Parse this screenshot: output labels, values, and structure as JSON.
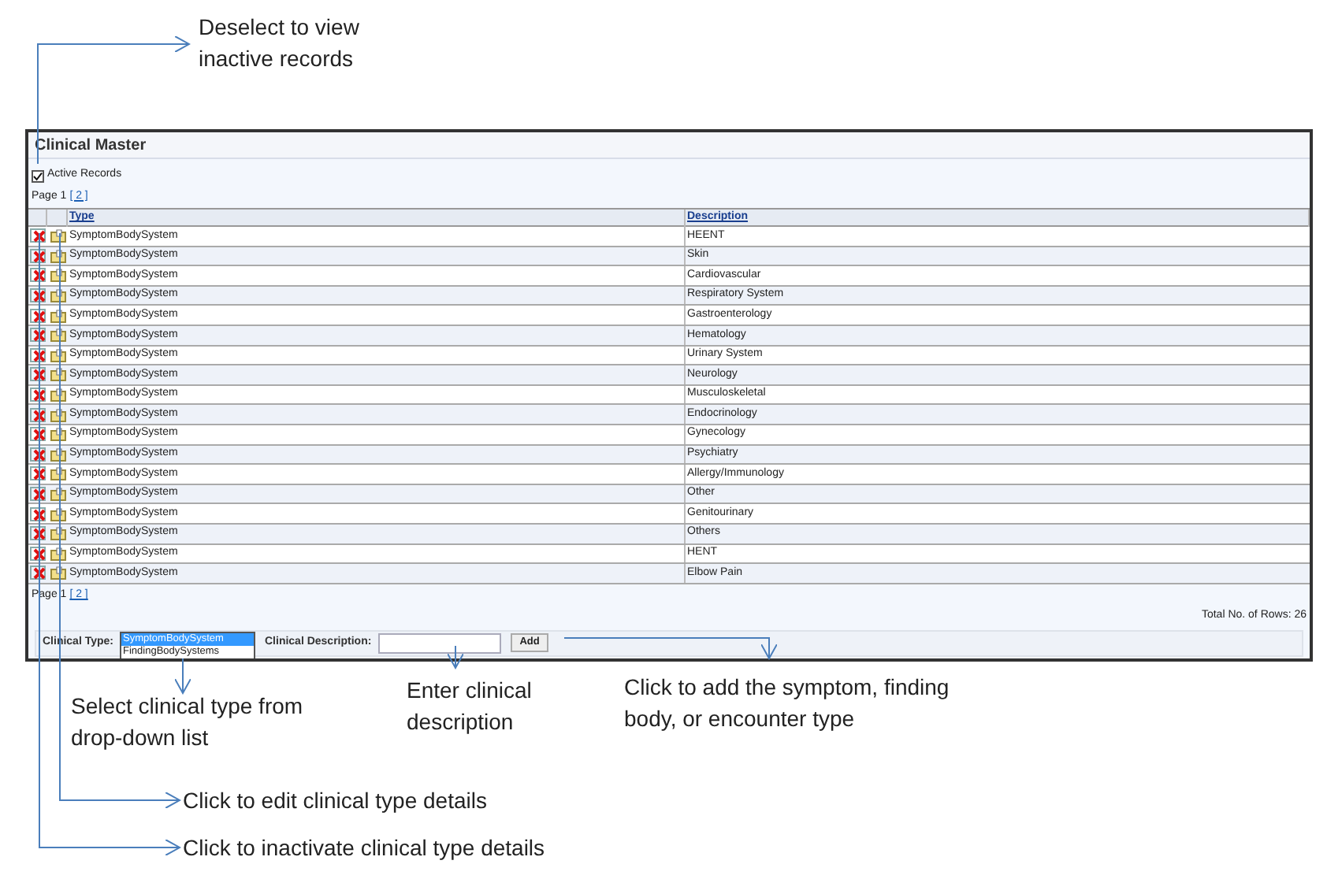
{
  "window": {
    "title": "Clinical Master"
  },
  "active_records": {
    "label": "Active Records",
    "checked": true
  },
  "pager_top": {
    "label": "Page 1",
    "link": "[ 2 ]"
  },
  "table": {
    "columns": [
      "Type",
      "Description"
    ],
    "rows": [
      {
        "type": "SymptomBodySystem",
        "description": "HEENT"
      },
      {
        "type": "SymptomBodySystem",
        "description": "Skin"
      },
      {
        "type": "SymptomBodySystem",
        "description": "Cardiovascular"
      },
      {
        "type": "SymptomBodySystem",
        "description": "Respiratory System"
      },
      {
        "type": "SymptomBodySystem",
        "description": "Gastroenterology"
      },
      {
        "type": "SymptomBodySystem",
        "description": "Hematology"
      },
      {
        "type": "SymptomBodySystem",
        "description": "Urinary System"
      },
      {
        "type": "SymptomBodySystem",
        "description": "Neurology"
      },
      {
        "type": "SymptomBodySystem",
        "description": "Musculoskeletal"
      },
      {
        "type": "SymptomBodySystem",
        "description": "Endocrinology"
      },
      {
        "type": "SymptomBodySystem",
        "description": "Gynecology"
      },
      {
        "type": "SymptomBodySystem",
        "description": "Psychiatry"
      },
      {
        "type": "SymptomBodySystem",
        "description": "Allergy/Immunology"
      },
      {
        "type": "SymptomBodySystem",
        "description": "Other"
      },
      {
        "type": "SymptomBodySystem",
        "description": "Genitourinary"
      },
      {
        "type": "SymptomBodySystem",
        "description": "Others"
      },
      {
        "type": "SymptomBodySystem",
        "description": "HENT"
      },
      {
        "type": "SymptomBodySystem",
        "description": "Elbow Pain"
      }
    ]
  },
  "pager_bottom": {
    "label": "Page 1",
    "link": "[ 2 ]"
  },
  "total_rows": "Total No. of Rows: 26",
  "form": {
    "type_label": "Clinical Type:",
    "type_options": [
      {
        "label": "SymptomBodySystem",
        "selected": true
      },
      {
        "label": "FindingBodySystems",
        "selected": false
      }
    ],
    "description_label": "Clinical Description:",
    "add_button": "Add"
  },
  "callouts": [
    {
      "lines": [
        "Deselect to view",
        "inactive records"
      ]
    },
    {
      "lines": [
        "Select clinical type from",
        "drop-down list"
      ]
    },
    {
      "lines": [
        "Enter clinical",
        "description"
      ]
    },
    {
      "lines": [
        "Click to add the symptom, finding",
        "body, or encounter type"
      ]
    },
    {
      "lines": [
        "Click to edit clinical type details"
      ]
    },
    {
      "lines": [
        "Click to inactivate clinical type details"
      ]
    }
  ]
}
